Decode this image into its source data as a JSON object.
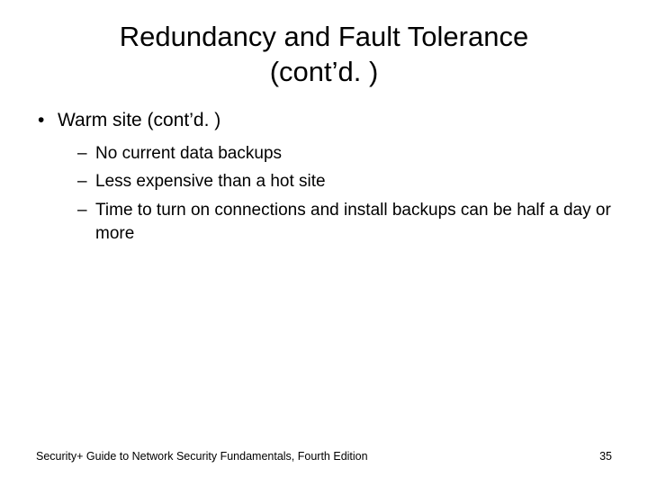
{
  "title_line1": "Redundancy and Fault Tolerance",
  "title_line2": "(cont’d. )",
  "bullets": {
    "item0": {
      "text": "Warm site (cont’d. )",
      "sub": {
        "s0": "No current data backups",
        "s1": "Less expensive than a hot site",
        "s2": "Time to turn on connections and install backups can be half a day or more"
      }
    }
  },
  "footer": "Security+ Guide to Network Security Fundamentals, Fourth Edition",
  "page_number": "35"
}
